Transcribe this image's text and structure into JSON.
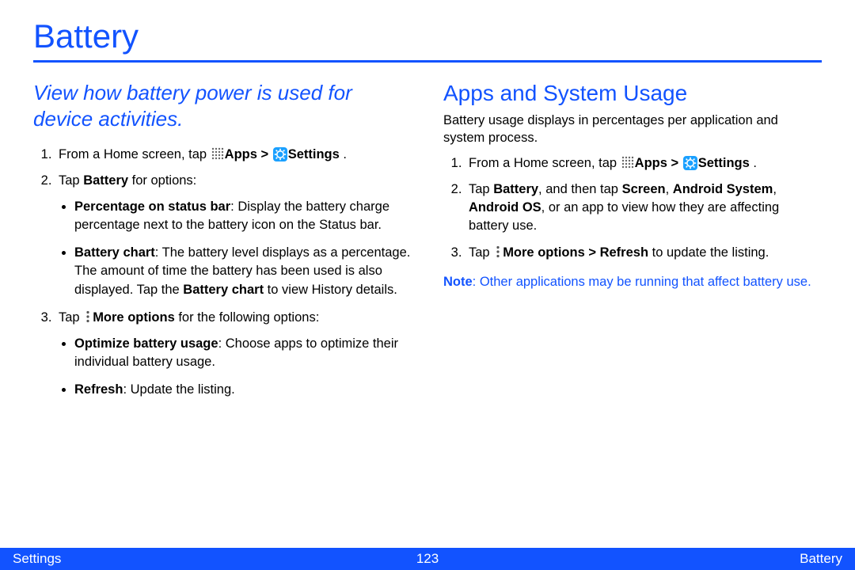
{
  "title": "Battery",
  "left": {
    "subtitle": "View how battery power is used for device activities.",
    "step1_pre": "From a Home screen, tap ",
    "apps_label": "Apps",
    "gt": " > ",
    "settings_label": "Settings",
    "period": " .",
    "step2_pre": "Tap ",
    "step2_bold": "Battery",
    "step2_post": " for options:",
    "b1_bold": "Percentage on status bar",
    "b1_text": ": Display the battery charge percentage next to the battery icon on the Status bar.",
    "b2_bold": "Battery chart",
    "b2_text": ": The battery level displays as a percentage. The amount of time the battery has been used is also displayed. Tap the ",
    "b2_bold2": "Battery chart",
    "b2_text2": " to view History details.",
    "step3_pre": "Tap ",
    "step3_bold": "More options",
    "step3_post": " for the following options:",
    "b3_bold": "Optimize battery usage",
    "b3_text": ": Choose apps to optimize their individual battery usage.",
    "b4_bold": "Refresh",
    "b4_text": ": Update the listing."
  },
  "right": {
    "section": "Apps and System Usage",
    "intro": "Battery usage displays in percentages per application and system process.",
    "step1_pre": "From a Home screen, tap ",
    "apps_label": "Apps",
    "gt": " > ",
    "settings_label": "Settings",
    "period": " .",
    "step2_pre": "Tap ",
    "step2_bold1": "Battery",
    "step2_mid": ", and then tap ",
    "step2_bold2": "Screen",
    "step2_c1": ", ",
    "step2_bold3": "Android System",
    "step2_c2": ", ",
    "step2_bold4": "Android OS",
    "step2_post": ", or an app to view how they are affecting battery use.",
    "step3_pre": "Tap ",
    "step3_bold1": "More options",
    "step3_gt": " > ",
    "step3_bold2": "Refresh",
    "step3_post": " to update the listing.",
    "note_bold": "Note",
    "note_text": ": Other applications may be running that affect battery use."
  },
  "footer": {
    "left": "Settings",
    "center": "123",
    "right": "Battery"
  }
}
